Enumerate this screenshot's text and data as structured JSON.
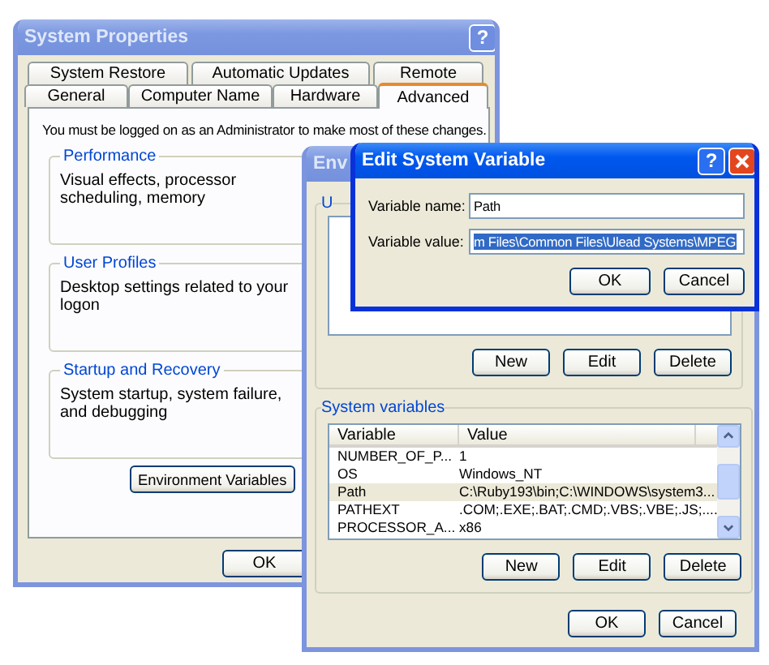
{
  "system_properties": {
    "title": "System Properties",
    "active": false,
    "help_button": "?",
    "tab_rows": [
      [
        {
          "label": "System Restore",
          "selected": false
        },
        {
          "label": "Automatic Updates",
          "selected": false
        },
        {
          "label": "Remote",
          "selected": false
        }
      ],
      [
        {
          "label": "General",
          "selected": false
        },
        {
          "label": "Computer Name",
          "selected": false
        },
        {
          "label": "Hardware",
          "selected": false
        },
        {
          "label": "Advanced",
          "selected": true
        }
      ]
    ],
    "notice": "You must be logged on as an Administrator to make most of these changes.",
    "groups": [
      {
        "label": "Performance",
        "description": "Visual effects, processor scheduling, memory"
      },
      {
        "label": "User Profiles",
        "description": "Desktop settings related to your logon"
      },
      {
        "label": "Startup and Recovery",
        "description": "System startup, system failure, and debugging"
      }
    ],
    "environment_button": "Environment Variables",
    "buttons": [
      "OK"
    ]
  },
  "environment_variables": {
    "title": "Env",
    "active": false,
    "user_group": {
      "label": "U",
      "buttons": [
        "New",
        "Edit",
        "Delete"
      ]
    },
    "system_group": {
      "label": "System variables",
      "columns": [
        "Variable",
        "Value"
      ],
      "rows": [
        {
          "variable": "NUMBER_OF_P...",
          "value": "1",
          "selected": false
        },
        {
          "variable": "OS",
          "value": "Windows_NT",
          "selected": false
        },
        {
          "variable": "Path",
          "value": "C:\\Ruby193\\bin;C:\\WINDOWS\\system3...",
          "selected": true
        },
        {
          "variable": "PATHEXT",
          "value": ".COM;.EXE;.BAT;.CMD;.VBS;.VBE;.JS;....",
          "selected": false
        },
        {
          "variable": "PROCESSOR_A...",
          "value": "x86",
          "selected": false
        }
      ],
      "buttons": [
        "New",
        "Edit",
        "Delete"
      ]
    },
    "buttons": [
      "OK",
      "Cancel"
    ]
  },
  "edit_dialog": {
    "title": "Edit System Variable",
    "active": true,
    "help_button": "?",
    "fields": [
      {
        "label": "Variable name:",
        "value": "Path",
        "selected": false
      },
      {
        "label": "Variable value:",
        "value": "m Files\\Common Files\\Ulead Systems\\MPEG",
        "selected": true
      }
    ],
    "buttons": [
      "OK",
      "Cancel"
    ]
  }
}
